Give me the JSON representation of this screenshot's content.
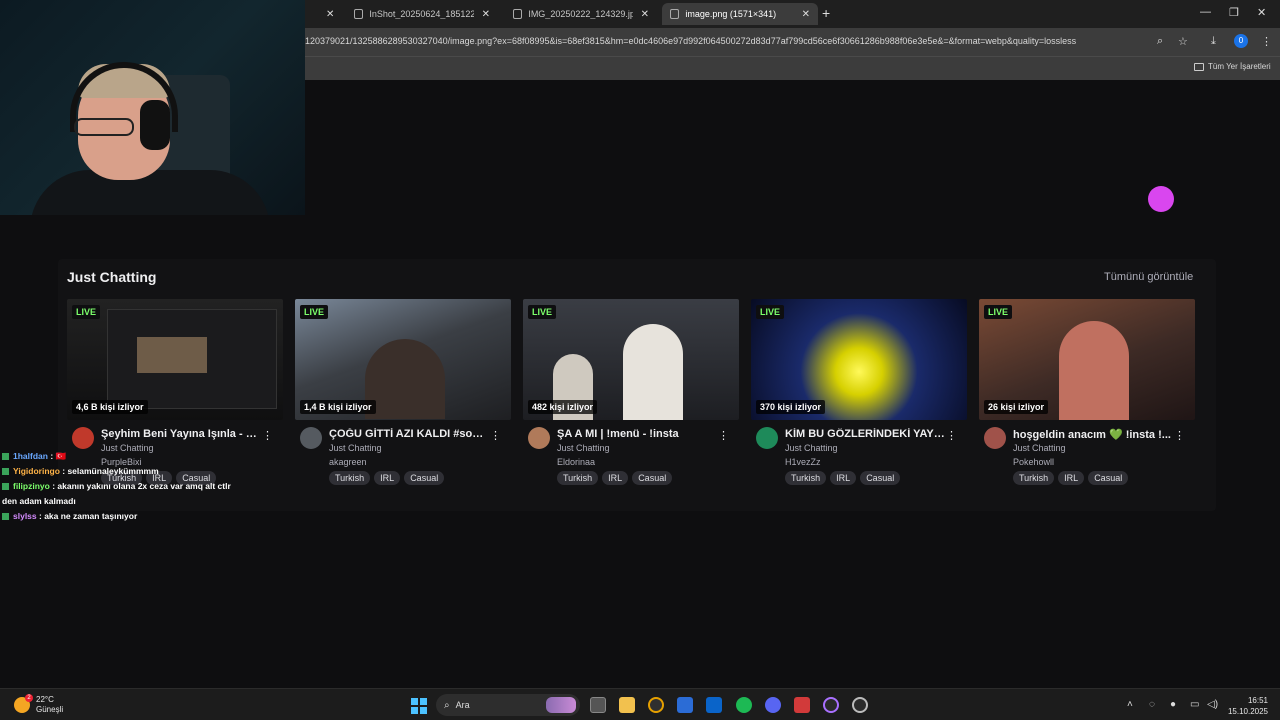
{
  "browser": {
    "tabs": [
      {
        "title": "InShot_20250624_185122743.jp",
        "active": false
      },
      {
        "title": "IMG_20250222_124329.jpg (99",
        "active": false
      },
      {
        "title": "image.png (1571×341)",
        "active": true
      }
    ],
    "url": "120379021/1325886289530327040/image.png?ex=68f08995&is=68ef3815&hm=e0dc4606e97d992f064500272d83d77af799cd56ce6f30661286b988f06e3e5e&=&format=webp&quality=lossless",
    "extension_badge": "0",
    "bookmarks_label": "Tüm Yer İşaretleri"
  },
  "section": {
    "title": "Just Chatting",
    "view_all": "Tümünü görüntüle"
  },
  "live_label": "LIVE",
  "streams": [
    {
      "viewers": "4,6 B kişi izliyor",
      "title": "Şeyhim Beni Yayına Işınla - G...",
      "category": "Just Chatting",
      "channel": "PurpleBixi",
      "tags": [
        "Turkish",
        "IRL",
        "Casual"
      ],
      "avatar_color": "#c0392b"
    },
    {
      "viewers": "1,4 B kişi izliyor",
      "title": "ÇOĞU GİTTİ AZI KALDI #son1...",
      "category": "Just Chatting",
      "channel": "akagreen",
      "tags": [
        "Turkish",
        "IRL",
        "Casual"
      ],
      "avatar_color": "#555a60"
    },
    {
      "viewers": "482 kişi izliyor",
      "title": "ŞA A MI | !menü - !insta",
      "category": "Just Chatting",
      "channel": "Eldorinaa",
      "tags": [
        "Turkish",
        "IRL",
        "Casual"
      ],
      "avatar_color": "#b07a5a"
    },
    {
      "viewers": "370 kişi izliyor",
      "title": "KİM BU GÖZLERİNDEKİ YAYI...",
      "category": "Just Chatting",
      "channel": "H1vezZz",
      "tags": [
        "Turkish",
        "IRL",
        "Casual"
      ],
      "avatar_color": "#1e8a5a"
    },
    {
      "viewers": "26 kişi izliyor",
      "title": "hoşgeldin anacım 💚 !insta !...",
      "category": "Just Chatting",
      "channel": "Pokehowll",
      "tags": [
        "Turkish",
        "IRL",
        "Casual"
      ],
      "avatar_color": "#a0524a"
    }
  ],
  "chat": [
    {
      "user": "1halfdan",
      "user_color": "#6aa8ff",
      "message": " : 🇹🇷"
    },
    {
      "user": "Yigidoringo",
      "user_color": "#ffb347",
      "message": " : selamünaleykümmmm"
    },
    {
      "user": "filipzinyo",
      "user_color": "#7cff6b",
      "message": " : akanın yakını olana 2x ceza var amq alt ctlr den adam kalmadı"
    },
    {
      "user": "slylss",
      "user_color": "#d58cff",
      "message": " : aka ne zaman taşınıyor"
    }
  ],
  "taskbar": {
    "temperature": "22°C",
    "weather": "Güneşli",
    "weather_badge": "2",
    "search_placeholder": "Ara",
    "time": "16:51",
    "date": "15.10.2025"
  }
}
